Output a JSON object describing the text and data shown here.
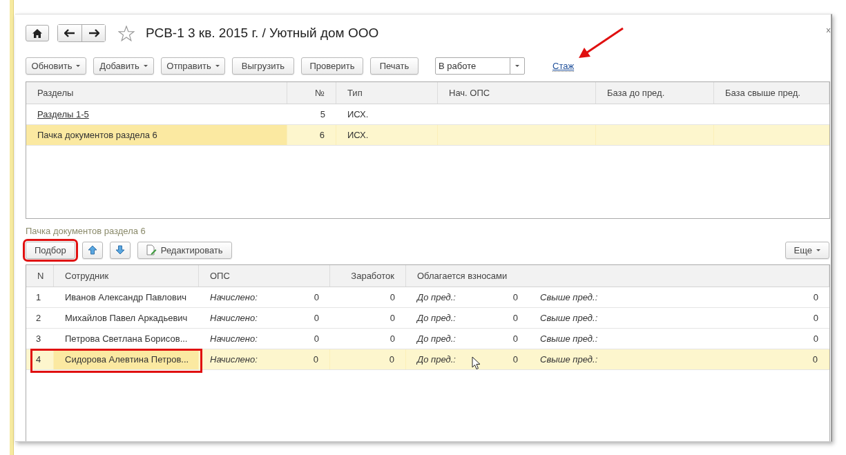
{
  "window": {
    "title": "РСВ-1 3 кв. 2015 г. / Уютный дом ООО"
  },
  "toolbar": {
    "buttons": [
      {
        "label": "Обновить",
        "dropdown": true
      },
      {
        "label": "Добавить",
        "dropdown": true
      },
      {
        "label": "Отправить",
        "dropdown": true
      },
      {
        "label": "Выгрузить",
        "dropdown": false
      },
      {
        "label": "Проверить",
        "dropdown": false
      },
      {
        "label": "Печать",
        "dropdown": false
      }
    ],
    "status_select": {
      "value": "В работе"
    },
    "link": {
      "label": "Стаж",
      "annotated": true
    }
  },
  "sections_table": {
    "columns": [
      "Разделы",
      "№",
      "Тип",
      "Нач. ОПС",
      "База до пред.",
      "База свыше пред."
    ],
    "rows": [
      {
        "name": "Разделы 1-5",
        "link": true,
        "number": "5",
        "type": "ИСХ.",
        "selected": false
      },
      {
        "name": "Пачка документов раздела 6",
        "link": false,
        "number": "6",
        "type": "ИСХ.",
        "selected": true
      }
    ]
  },
  "batch": {
    "title": "Пачка документов раздела 6",
    "buttons": [
      {
        "kind": "text",
        "label": "Подбор",
        "highlighted": true
      },
      {
        "kind": "up"
      },
      {
        "kind": "down"
      },
      {
        "kind": "edit",
        "label": "Редактировать"
      }
    ],
    "more_button": "Еще",
    "columns": [
      "N",
      "Сотрудник",
      "ОПС",
      "Заработок",
      "Облагается взносами"
    ],
    "rows": [
      {
        "n": "1",
        "employee": "Иванов Александр Павлович",
        "ops_label": "Начислено:",
        "ops_value": "0",
        "earnings": "0",
        "below_label": "До пред.:",
        "below_value": "0",
        "above_label": "Свыше пред.:",
        "above_value": "0",
        "selected": false,
        "highlighted": false
      },
      {
        "n": "2",
        "employee": "Михайлов Павел Аркадьевич",
        "ops_label": "Начислено:",
        "ops_value": "0",
        "earnings": "0",
        "below_label": "До пред.:",
        "below_value": "0",
        "above_label": "Свыше пред.:",
        "above_value": "0",
        "selected": false,
        "highlighted": false
      },
      {
        "n": "3",
        "employee": "Петрова Светлана Борисов...",
        "ops_label": "Начислено:",
        "ops_value": "0",
        "earnings": "0",
        "below_label": "До пред.:",
        "below_value": "0",
        "above_label": "Свыше пред.:",
        "above_value": "0",
        "selected": false,
        "highlighted": false
      },
      {
        "n": "4",
        "employee": "Сидорова Алевтина Петров...",
        "ops_label": "Начислено:",
        "ops_value": "0",
        "earnings": "0",
        "below_label": "До пред.:",
        "below_value": "0",
        "above_label": "Свыше пред.:",
        "above_value": "0",
        "selected": true,
        "highlighted": true
      }
    ]
  }
}
